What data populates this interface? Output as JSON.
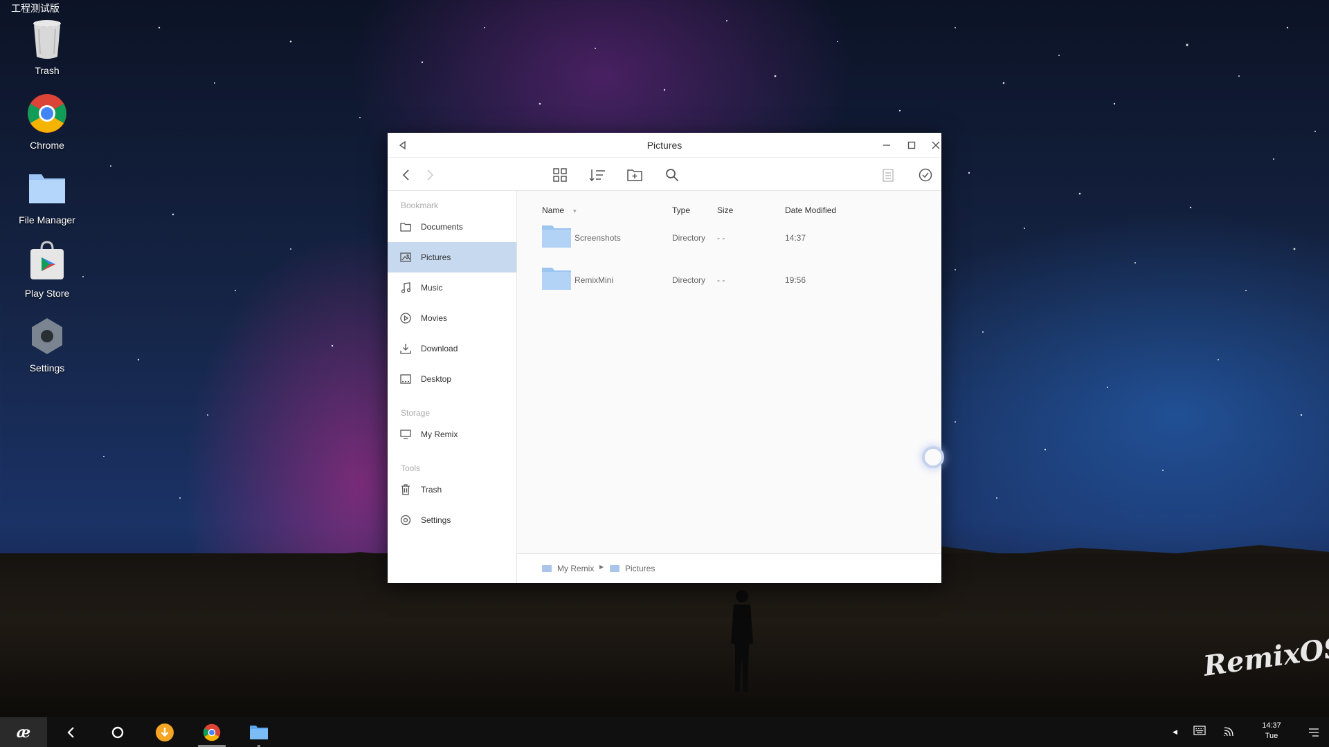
{
  "status_bar": {
    "label": "工程测试版"
  },
  "desktop": {
    "icons": [
      {
        "label": "Trash",
        "icon": "trash-icon"
      },
      {
        "label": "Chrome",
        "icon": "chrome-icon"
      },
      {
        "label": "File Manager",
        "icon": "folder-icon"
      },
      {
        "label": "Play Store",
        "icon": "play-store-icon"
      },
      {
        "label": "Settings",
        "icon": "settings-hex-icon"
      }
    ],
    "watermark": "RemixOS"
  },
  "window": {
    "title": "Pictures",
    "sidebar": {
      "sections": [
        {
          "label": "Bookmark",
          "items": [
            {
              "label": "Documents",
              "icon": "folder-outline-icon"
            },
            {
              "label": "Pictures",
              "icon": "image-icon",
              "active": true
            },
            {
              "label": "Music",
              "icon": "music-note-icon"
            },
            {
              "label": "Movies",
              "icon": "play-circle-icon"
            },
            {
              "label": "Download",
              "icon": "download-icon"
            },
            {
              "label": "Desktop",
              "icon": "desktop-icon"
            }
          ]
        },
        {
          "label": "Storage",
          "items": [
            {
              "label": "My Remix",
              "icon": "monitor-icon"
            }
          ]
        },
        {
          "label": "Tools",
          "items": [
            {
              "label": "Trash",
              "icon": "trash-outline-icon"
            },
            {
              "label": "Settings",
              "icon": "gear-icon"
            }
          ]
        }
      ]
    },
    "columns": {
      "name": "Name",
      "type": "Type",
      "size": "Size",
      "date": "Date Modified"
    },
    "files": [
      {
        "name": "Screenshots",
        "type": "Directory",
        "size": "- -",
        "date": "14:37"
      },
      {
        "name": "RemixMini",
        "type": "Directory",
        "size": "- -",
        "date": "19:56"
      }
    ],
    "breadcrumb": [
      "My Remix",
      "Pictures"
    ]
  },
  "taskbar": {
    "time": "14:37",
    "day": "Tue",
    "colors": {
      "accent": "#c7d9ef",
      "folder": "#a9c6ea"
    }
  }
}
